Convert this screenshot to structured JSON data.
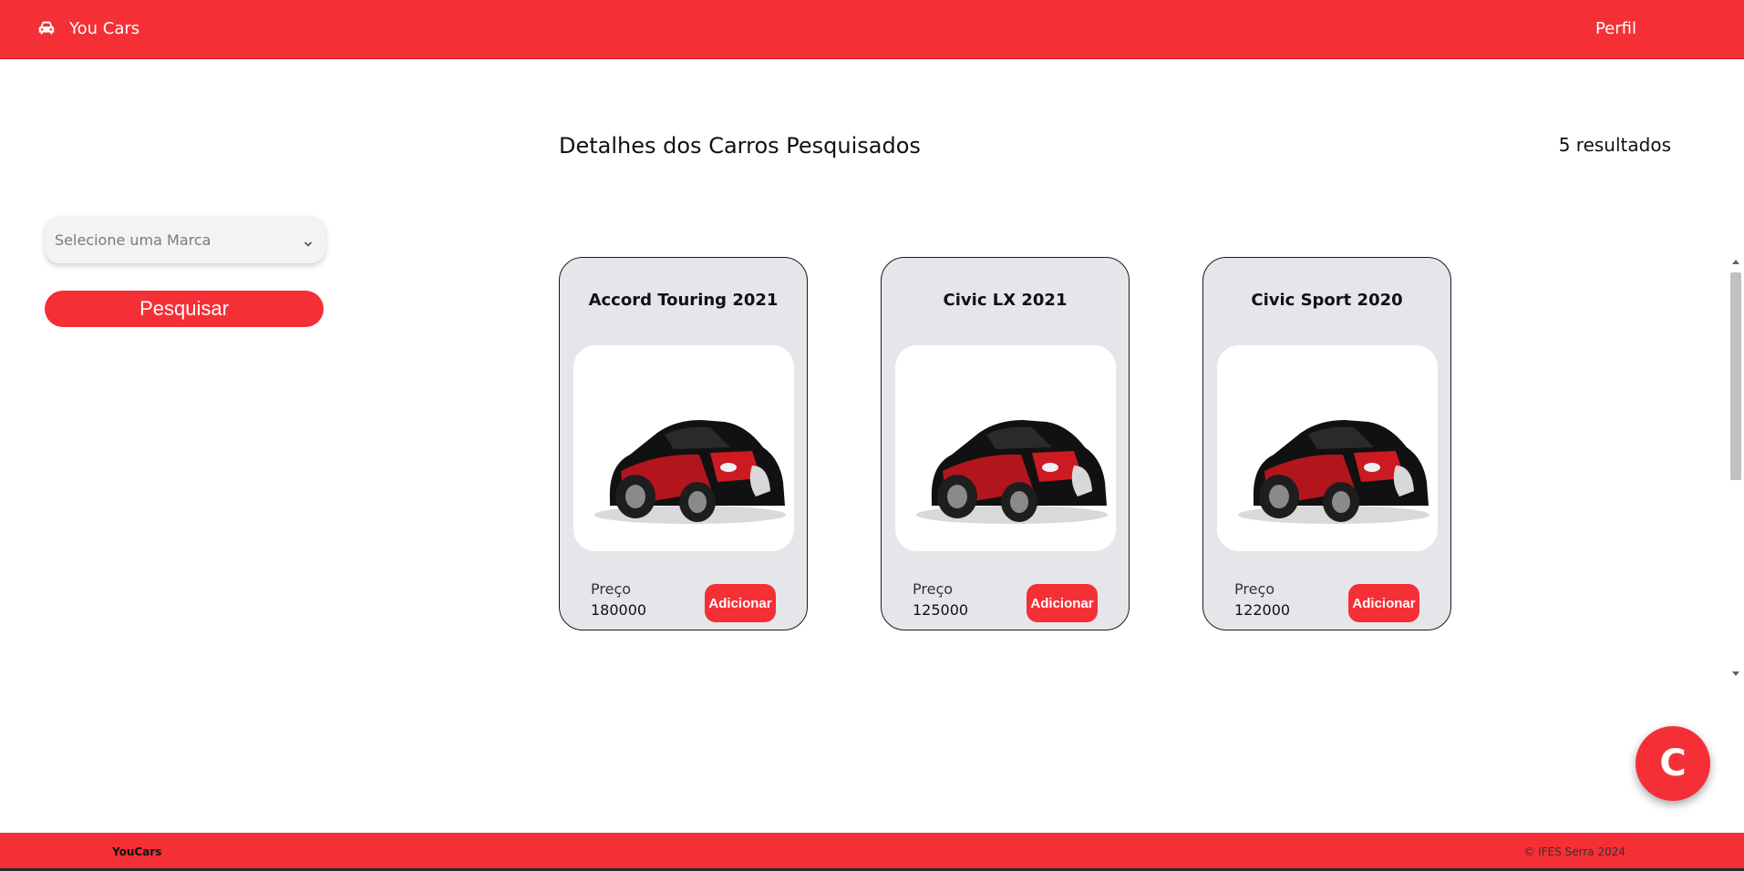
{
  "navbar": {
    "brand_icon": "car-icon",
    "brand_label": "You Cars",
    "profile_label": "Perfil"
  },
  "sidebar": {
    "brand_select": {
      "selected": "Selecione uma Marca",
      "icon": "chevron-down-icon"
    },
    "search_label": "Pesquisar"
  },
  "main": {
    "title": "Detalhes dos Carros Pesquisados",
    "results_count": "5 resultados",
    "cards": [
      {
        "title": "Accord Touring 2021",
        "price_label": "Preço",
        "price": "180000",
        "add_label": "Adicionar"
      },
      {
        "title": "Civic LX 2021",
        "price_label": "Preço",
        "price": "125000",
        "add_label": "Adicionar"
      },
      {
        "title": "Civic Sport 2020",
        "price_label": "Preço",
        "price": "122000",
        "add_label": "Adicionar"
      }
    ]
  },
  "chat_fab": {
    "label": "C"
  },
  "footer": {
    "brand": "YouCars",
    "copyright": "© IFES Serra 2024"
  },
  "colors": {
    "accent": "#f52f36",
    "card_bg": "#e5e6e9"
  }
}
